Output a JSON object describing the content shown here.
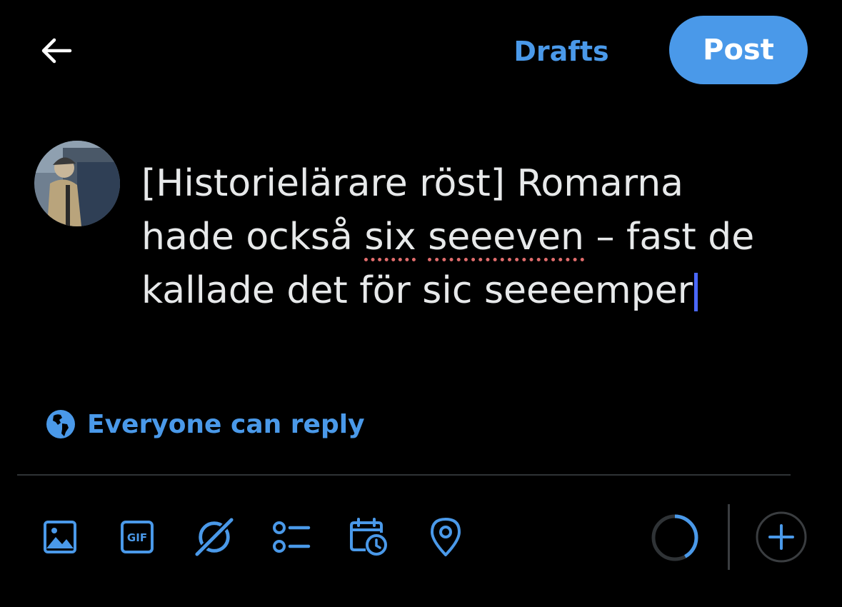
{
  "header": {
    "back_icon": "arrow-left-icon",
    "drafts_label": "Drafts",
    "post_label": "Post"
  },
  "composer": {
    "text_before": "[Historielärare röst] Romarna\nhade också ",
    "misspelled_1": "six",
    "text_middle": " ",
    "misspelled_2": "seeeven",
    "text_after": " – fast de\nkallade det för sic seeeemper"
  },
  "reply_setting": {
    "icon": "globe-icon",
    "label": "Everyone can reply"
  },
  "toolbar": {
    "items": [
      {
        "icon": "image-icon"
      },
      {
        "icon": "gif-icon",
        "label": "GIF"
      },
      {
        "icon": "grok-icon"
      },
      {
        "icon": "poll-icon"
      },
      {
        "icon": "schedule-icon"
      },
      {
        "icon": "location-icon"
      }
    ],
    "character_progress": 0.42,
    "add_icon": "plus-icon"
  },
  "colors": {
    "accent": "#4a99e9",
    "background": "#000000",
    "text": "#e7e9ea",
    "caret": "#4a68ff",
    "spellcheck": "#e06c6c"
  }
}
